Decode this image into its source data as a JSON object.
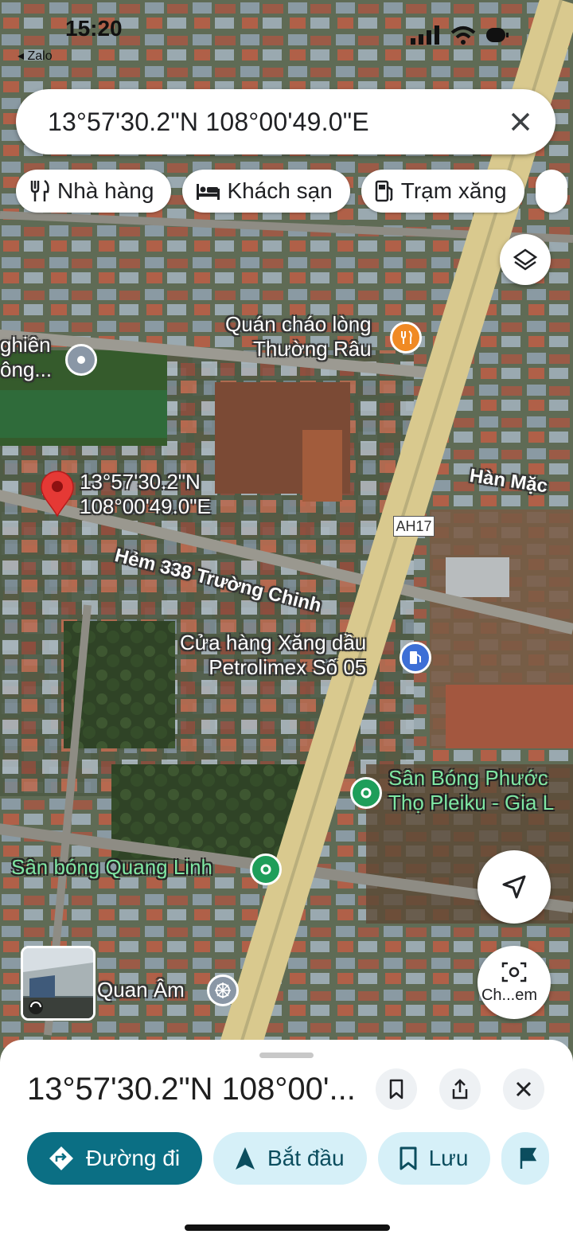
{
  "status": {
    "time": "15:20",
    "back_app": "◂ Zalo"
  },
  "search": {
    "query": "13°57'30.2\"N 108°00'49.0\"E"
  },
  "chips": [
    {
      "label": "Nhà hàng",
      "icon": "restaurant-icon"
    },
    {
      "label": "Khách sạn",
      "icon": "hotel-icon"
    },
    {
      "label": "Trạm xăng",
      "icon": "gas-station-icon"
    }
  ],
  "map": {
    "pin_coords_line1": "13°57'30.2\"N",
    "pin_coords_line2": "108°00'49.0\"E",
    "poi_restaurant_line1": "Quán cháo lòng",
    "poi_restaurant_line2": "Thường Râu",
    "poi_left_line1": "ghiên",
    "poi_left_line2": "ông...",
    "road_han_mac": "Hàn Mặc",
    "road_hem": "Hẻm 338 Trường Chinh",
    "route_shield": "AH17",
    "poi_gas_line1": "Cửa hàng Xăng dầu",
    "poi_gas_line2": "Petrolimex Số 05",
    "poi_field1_line1": "Sân Bóng Phước",
    "poi_field1_line2": "Thọ Pleiku - Gia L",
    "poi_field2": "Sân bóng Quang Linh",
    "poi_temple": "Quan Âm",
    "lens_label": "Ch...em"
  },
  "sheet": {
    "title": "13°57'30.2\"N 108°00'...",
    "actions": {
      "directions": "Đường đi",
      "start": "Bắt đầu",
      "save": "Lưu"
    }
  },
  "colors": {
    "accent": "#0b6f84",
    "secondary_bg": "#d6f0f8",
    "pin_red": "#e53935",
    "poi_orange": "#f08a24",
    "poi_green": "#1e9e5a",
    "poi_blue": "#3d6fd6"
  }
}
